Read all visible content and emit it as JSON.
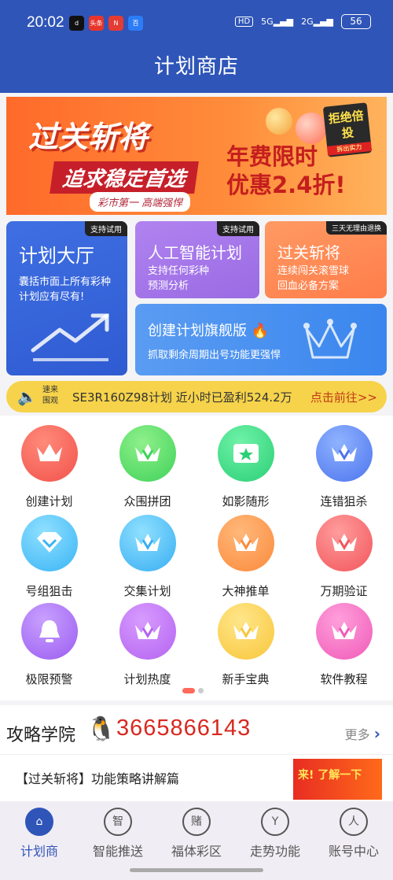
{
  "status": {
    "time": "20:02",
    "apps": [
      "d",
      "头条",
      "N",
      "百"
    ],
    "hd": "HD",
    "signal1": "5G",
    "signal2": "2G",
    "battery": "56"
  },
  "header": {
    "title": "计划商店"
  },
  "banner": {
    "line1": "过关斩将",
    "line2": "追求稳定首选",
    "line3": "彩市第一  高端强悍",
    "promo_line1": "年费限时",
    "promo_line2": "优惠2.4折!",
    "stamp": "拒绝倍投",
    "stamp_small": "拆出实力"
  },
  "cards": {
    "hall": {
      "tag": "支持试用",
      "title": "计划大厅",
      "desc1": "囊括市面上所有彩种",
      "desc2": "计划应有尽有!"
    },
    "ai": {
      "tag": "支持试用",
      "title": "人工智能计划",
      "desc1": "支持任何彩种",
      "desc2": "预测分析"
    },
    "pass": {
      "tag": "三天无理由退换",
      "title": "过关斩将",
      "desc1": "连续闯关滚雪球",
      "desc2": "回血必备方案"
    },
    "flag": {
      "title": "创建计划旗舰版",
      "desc": "抓取剩余周期出号功能更强悍"
    }
  },
  "notice": {
    "tag1": "速来",
    "tag2": "围观",
    "text": "SE3R160Z98计划 近小时已盈利524.2万",
    "link": "点击前往>>"
  },
  "grid": [
    {
      "label": "创建计划",
      "color1": "#ff8a7a",
      "color2": "#f2524a",
      "icon": "crown-icon"
    },
    {
      "label": "众围拼团",
      "color1": "#8ff08a",
      "color2": "#3fd25a",
      "icon": "crown-v-icon"
    },
    {
      "label": "如影随形",
      "color1": "#6ff2a8",
      "color2": "#2bcf76",
      "icon": "ticket-icon"
    },
    {
      "label": "连错狙杀",
      "color1": "#8fb3ff",
      "color2": "#4d74ee",
      "icon": "crown-v-icon"
    },
    {
      "label": "号组狙击",
      "color1": "#8fe0ff",
      "color2": "#3ab4f5",
      "icon": "diamond-icon"
    },
    {
      "label": "交集计划",
      "color1": "#8fe0ff",
      "color2": "#38aef2",
      "icon": "crown-v-icon"
    },
    {
      "label": "大神推单",
      "color1": "#ffb87a",
      "color2": "#fb8a3c",
      "icon": "crown-v-icon"
    },
    {
      "label": "万期验证",
      "color1": "#ff9c9c",
      "color2": "#f2555a",
      "icon": "crown-v-icon"
    },
    {
      "label": "极限预警",
      "color1": "#c8a0ff",
      "color2": "#9b5cf0",
      "icon": "bell-icon"
    },
    {
      "label": "计划热度",
      "color1": "#d79bff",
      "color2": "#b463f0",
      "icon": "crown-v-icon"
    },
    {
      "label": "新手宝典",
      "color1": "#ffe68a",
      "color2": "#f8c63a",
      "icon": "crown-v-icon"
    },
    {
      "label": "软件教程",
      "color1": "#ff9fdb",
      "color2": "#f05ab8",
      "icon": "crown-v-icon"
    }
  ],
  "academy": {
    "title": "攻略学院",
    "phone": "3665866143",
    "more": "更多",
    "article": "【过关斩将】功能策略讲解篇",
    "thumb": "来! 了解一下"
  },
  "tabs": [
    {
      "label": "计划商",
      "glyph": "⌂",
      "icon": "home-icon"
    },
    {
      "label": "智能推送",
      "glyph": "智",
      "icon": "smart-push-icon"
    },
    {
      "label": "福体彩区",
      "glyph": "赌",
      "icon": "lottery-icon"
    },
    {
      "label": "走势功能",
      "glyph": "Y",
      "icon": "trend-icon"
    },
    {
      "label": "账号中心",
      "glyph": "人",
      "icon": "account-icon"
    }
  ]
}
